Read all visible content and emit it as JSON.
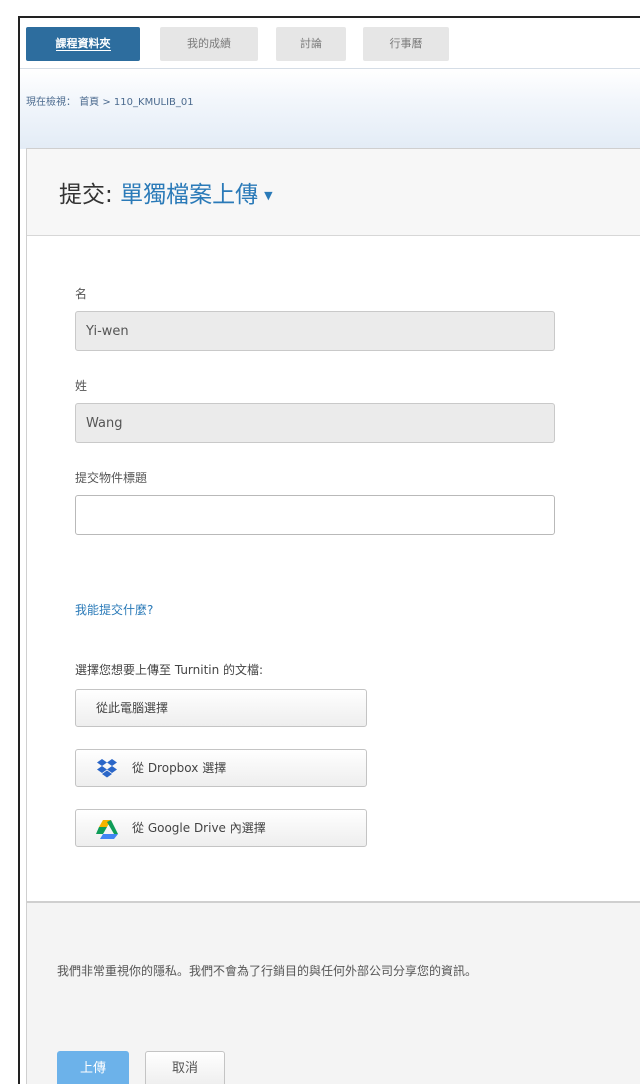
{
  "nav": {
    "tabs": [
      {
        "label": "課程資料夾"
      },
      {
        "label": "我的成績"
      },
      {
        "label": "討論"
      },
      {
        "label": "行事曆"
      }
    ]
  },
  "breadcrumb": {
    "prefix": "現在檢視：",
    "path": "首頁 > 110_KMULIB_01"
  },
  "submission": {
    "heading_prefix": "提交:",
    "heading_type": "單獨檔案上傳"
  },
  "form": {
    "first_name_label": "名",
    "first_name_value": "Yi-wen",
    "last_name_label": "姓",
    "last_name_value": "Wang",
    "title_label": "提交物件標題",
    "title_value": "",
    "help_link": "我能提交什麼?",
    "choose_label": "選擇您想要上傳至 Turnitin 的文檔:",
    "from_computer": "從此電腦選擇",
    "from_dropbox": "從 Dropbox 選擇",
    "from_gdrive": "從 Google Drive 內選擇"
  },
  "footer": {
    "privacy": "我們非常重視你的隱私。我們不會為了行銷目的與任何外部公司分享您的資訊。",
    "upload_label": "上傳",
    "cancel_label": "取消"
  },
  "colors": {
    "active_tab": "#2d6d9e",
    "link": "#2a7ab8",
    "upload_button": "#6cb2ea"
  }
}
